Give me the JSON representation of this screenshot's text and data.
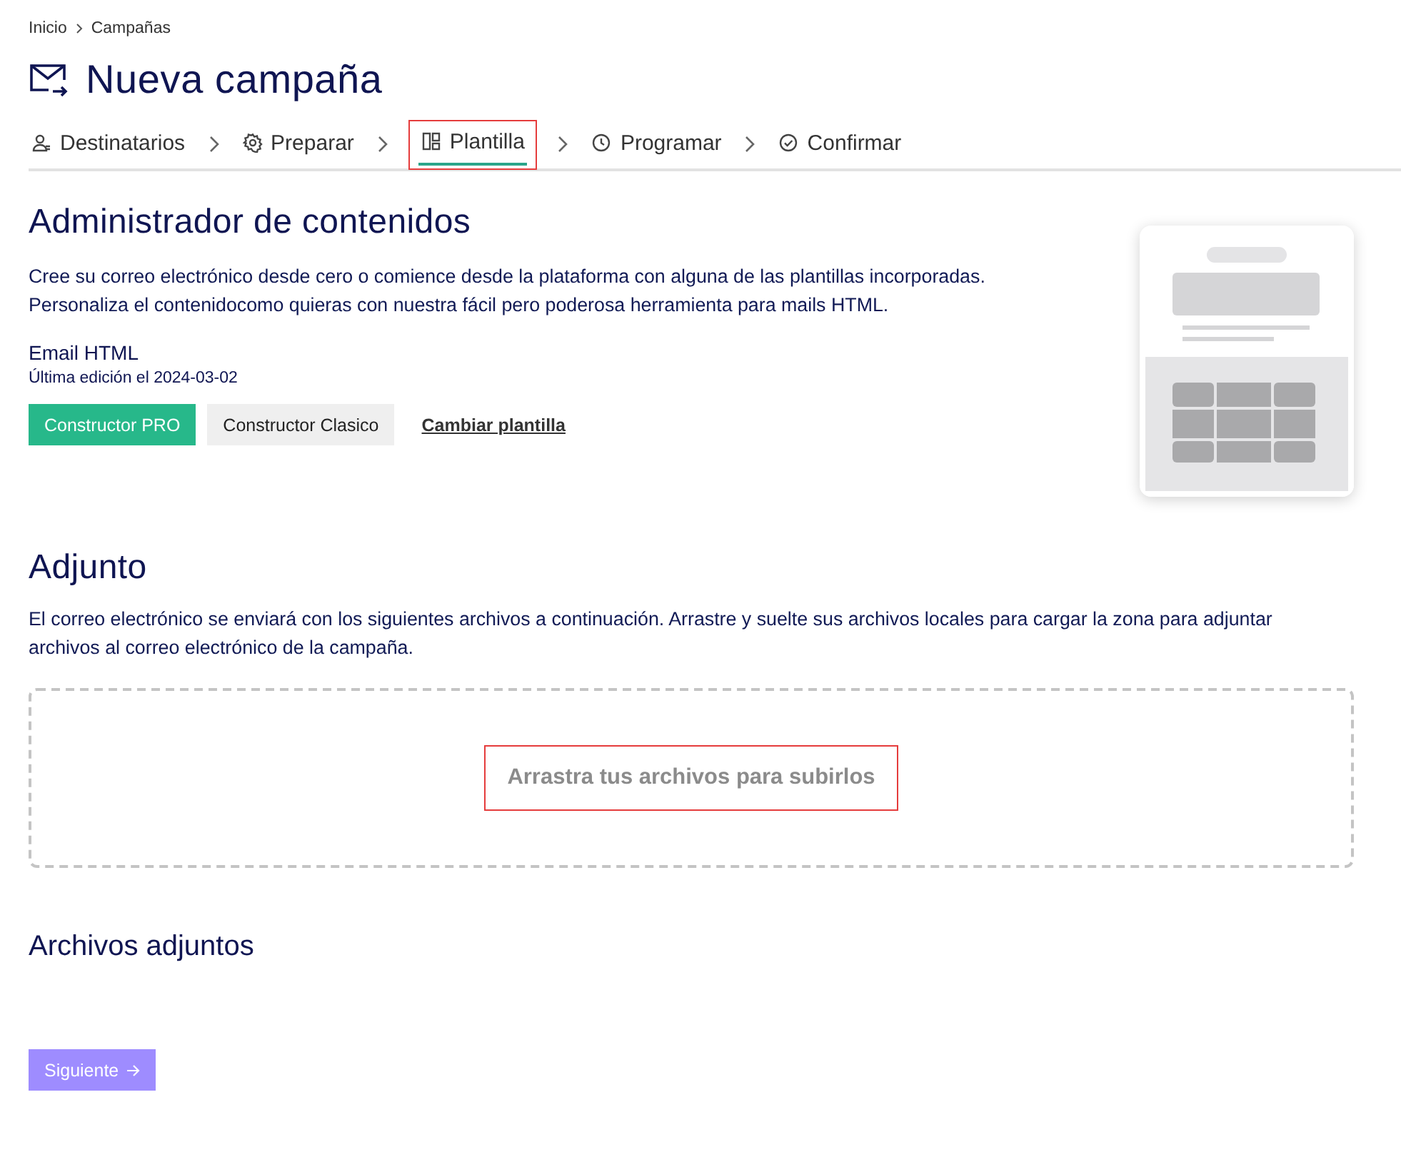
{
  "breadcrumb": [
    "Inicio",
    "Campañas"
  ],
  "page_title": "Nueva campaña",
  "steps": [
    {
      "label": "Destinatarios",
      "kind": "people",
      "selected": false,
      "highlighted": false
    },
    {
      "label": "Preparar",
      "kind": "gear",
      "selected": false,
      "highlighted": false
    },
    {
      "label": "Plantilla",
      "kind": "layout",
      "selected": true,
      "highlighted": true
    },
    {
      "label": "Programar",
      "kind": "clock",
      "selected": false,
      "highlighted": false
    },
    {
      "label": "Confirmar",
      "kind": "check",
      "selected": false,
      "highlighted": false
    }
  ],
  "content_manager": {
    "heading": "Administrador de contenidos",
    "description": "Cree su correo electrónico desde cero o comience desde la plataforma con alguna de las plantillas incorporadas. Personaliza el contenidocomo quieras con nuestra fácil pero poderosa herramienta para mails HTML.",
    "template_name": "Email HTML",
    "last_edited": "Última edición el 2024-03-02",
    "buttons": [
      {
        "label": "Constructor PRO",
        "kind": "primary"
      },
      {
        "label": "Constructor Clasico",
        "kind": "secondary"
      },
      {
        "label": "Cambiar plantilla",
        "kind": "link"
      }
    ]
  },
  "attachment": {
    "heading": "Adjunto",
    "description": "El correo electrónico se enviará con los siguientes archivos a continuación. Arrastre y suelte sus archivos locales para cargar la zona para adjuntar archivos al correo electrónico de la campaña.",
    "dropzone": {
      "text": "Arrastra tus archivos para subirlos",
      "highlighted": true
    }
  },
  "attached_files": {
    "heading": "Archivos adjuntos"
  },
  "next_button": {
    "label": "Siguiente"
  }
}
